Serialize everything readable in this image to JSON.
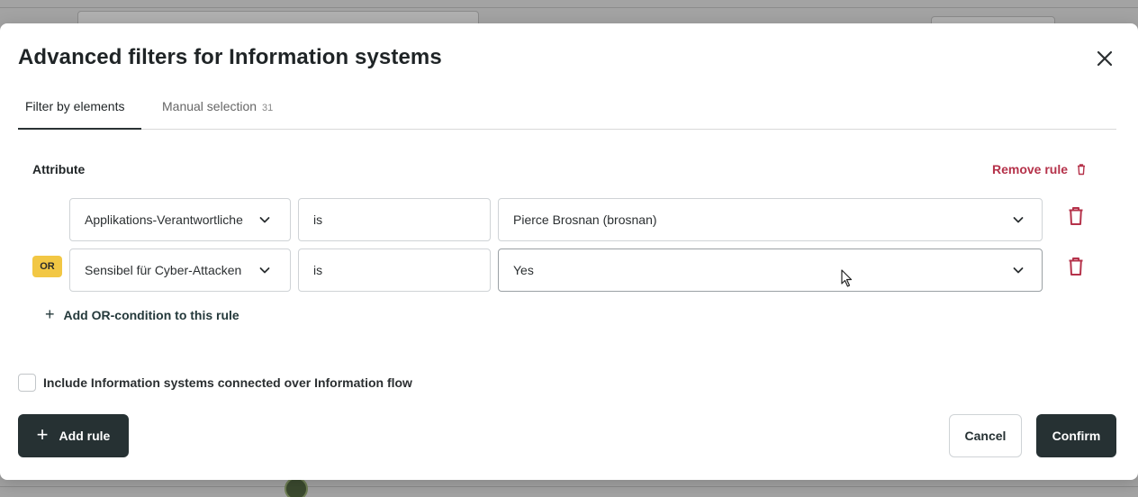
{
  "modal": {
    "title": "Advanced filters for Information systems",
    "close_icon": "close-icon"
  },
  "tabs": [
    {
      "label": "Filter by elements",
      "active": true
    },
    {
      "label": "Manual selection",
      "count": "31",
      "active": false
    }
  ],
  "rule": {
    "attribute_label": "Attribute",
    "remove_label": "Remove rule",
    "conditions": [
      {
        "attribute": "Applikations-Verantwortliche",
        "operator": "is",
        "value": "Pierce Brosnan (brosnan)"
      },
      {
        "connector": "OR",
        "attribute": "Sensibel für Cyber-Attacken",
        "operator": "is",
        "value": "Yes"
      }
    ],
    "add_or_label": "Add OR-condition to this rule"
  },
  "include": {
    "label": "Include Information systems connected over Information flow",
    "checked": false
  },
  "footer": {
    "add_rule_label": "Add rule",
    "cancel_label": "Cancel",
    "confirm_label": "Confirm"
  },
  "colors": {
    "primary_dark": "#263133",
    "danger": "#b5324a",
    "or_badge": "#f2c744"
  }
}
